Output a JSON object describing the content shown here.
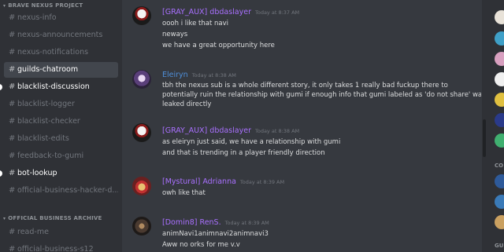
{
  "sidebar": {
    "categories": [
      {
        "label": "BRAVE NEXUS PROJECT"
      },
      {
        "label": "OFFICIAL BUSINESS ARCHIVE"
      }
    ],
    "channels": [
      {
        "label": "nexus-info"
      },
      {
        "label": "nexus-announcements"
      },
      {
        "label": "nexus-notifications"
      },
      {
        "label": "guilds-chatroom"
      },
      {
        "label": "blacklist-discussion"
      },
      {
        "label": "blacklist-logger"
      },
      {
        "label": "blacklist-checker"
      },
      {
        "label": "blacklist-edits"
      },
      {
        "label": "feedback-to-gumi"
      },
      {
        "label": "bot-lookup"
      },
      {
        "label": "official-business-hacker-d..."
      },
      {
        "label": "read-me"
      },
      {
        "label": "official-business-s12"
      }
    ]
  },
  "messages": [
    {
      "author": "[GRAY_AUX] dbdaslayer",
      "author_color": "#a970ff",
      "time": "Today at 8:37 AM",
      "lines": [
        "oooh i like that navi",
        "neways",
        "we have a great opportunity here"
      ]
    },
    {
      "author": "Eleiryn",
      "author_color": "#4f8fd9",
      "time": "Today at 8:38 AM",
      "lines": [
        "tbh the nexus sub is a whole different story, it only takes 1 really bad fuckup there to",
        "potentially ruin the relationship with gumi if enough info that gumi labeled as 'do not share' was",
        "leaked directly"
      ]
    },
    {
      "author": "[GRAY_AUX] dbdaslayer",
      "author_color": "#a970ff",
      "time": "Today at 8:38 AM",
      "lines": [
        "as eleiryn just said, we have a relationship with gumi",
        "and that is trending in a player friendly direction"
      ]
    },
    {
      "author": "[Mystural] Adrianna",
      "author_color": "#a970ff",
      "time": "Today at 8:39 AM",
      "lines": [
        "owh like that"
      ]
    },
    {
      "author": "[Domin8] RenS.",
      "author_color": "#a970ff",
      "time": "Today at 8:39 AM",
      "lines": [
        "animNavi1animnavi2animnavi3",
        "Aww no orks for me v.v"
      ]
    }
  ],
  "members": {
    "section_labels": [
      "CO",
      "GU"
    ]
  },
  "colors": {
    "background": "#36393f",
    "sidebar": "#2f3136",
    "selected_channel": "#42464d",
    "role_purple": "#a970ff",
    "role_blue": "#4f8fd9"
  }
}
